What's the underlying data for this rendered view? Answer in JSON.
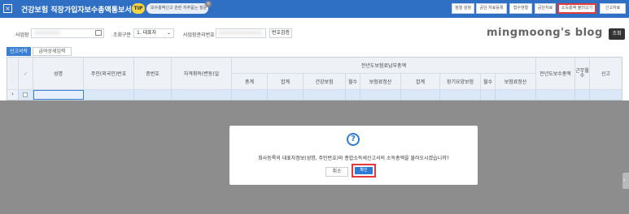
{
  "window": {
    "title": "건강보험 직장가입자보수총액통보서",
    "badge": "TIP",
    "notice": "보수총액신고 관련 자주묻는 질문"
  },
  "toolbar": [
    {
      "label": "정렬 설정"
    },
    {
      "label": "공단 자료등록"
    },
    {
      "label": "접수현황"
    },
    {
      "label": "공단자료"
    },
    {
      "label": "소득총액 불러오기"
    },
    {
      "label": "신고자료"
    }
  ],
  "search": {
    "company_label": "사업장",
    "company_value": "○○○○○○",
    "report_type_label": "조회구분",
    "report_type_value": "1. 대표자",
    "biz_no_label": "사업장관리번호",
    "biz_no_value": "○○○○○○○○○○",
    "verify_button": "번호검증",
    "blog_text": "mingmoong's blog",
    "search_button": "조회"
  },
  "tabs": [
    {
      "label": "신고서작",
      "active": true
    },
    {
      "label": "급여상세입력",
      "active": false
    }
  ],
  "grid": {
    "headers": {
      "name": "성명",
      "resident_no": "주민(외국인)번호",
      "cert_no": "증번호",
      "acquire_date": "자격취득(변동)일",
      "group_title": "전년도보험료납부총액",
      "total": "총계",
      "sum1": "합계",
      "health": "건강보험",
      "months1": "월수",
      "settle1": "보험료정산",
      "sum2": "합계",
      "ltc": "장기요양보험",
      "months2": "월수",
      "settle2": "보험료정산",
      "prev_salary": "전년도보수총액",
      "work_months": "근무월수",
      "report": "신고"
    },
    "row_marker": "›"
  },
  "dialog": {
    "icon": "question-icon",
    "message": "회사등록의 대표자정보(성명, 주민번호)와 종합소득세신고서의 소득총액을 불러오시겠습니까?",
    "cancel_label": "취소",
    "ok_label": "확인"
  },
  "colors": {
    "titlebar": "#2f6fc4",
    "accent": "#2e7bd6",
    "highlight": "#e43a3a"
  }
}
